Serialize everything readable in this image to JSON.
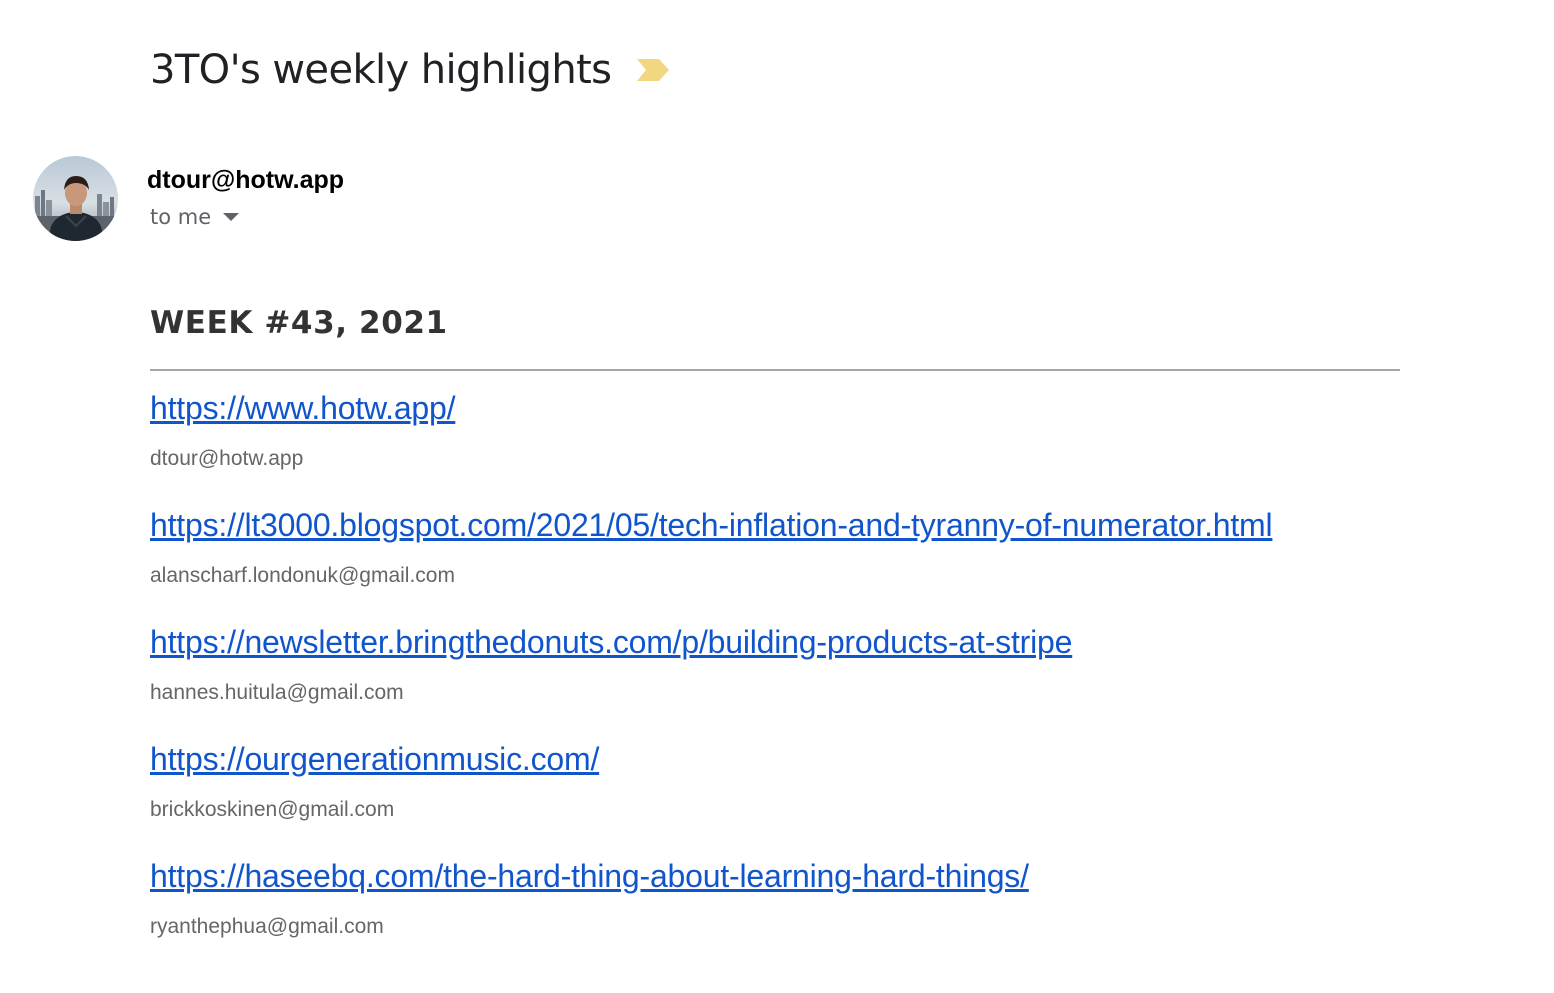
{
  "email": {
    "subject": "3TO's weekly highlights",
    "importance_marker": {
      "icon": "importance-arrow-icon",
      "color": "#f2d680"
    },
    "sender": "dtour@hotw.app",
    "recipient_label": "to me",
    "recipient_dropdown_icon": "caret-down-icon",
    "avatar_icon": "sender-avatar"
  },
  "body": {
    "week_heading": "WEEK #43, 2021",
    "entries": [
      {
        "url": "https://www.hotw.app/",
        "submitter": "dtour@hotw.app"
      },
      {
        "url": "https://lt3000.blogspot.com/2021/05/tech-inflation-and-tyranny-of-numerator.html",
        "submitter": "alanscharf.londonuk@gmail.com"
      },
      {
        "url": "https://newsletter.bringthedonuts.com/p/building-products-at-stripe",
        "submitter": "hannes.huitula@gmail.com"
      },
      {
        "url": "https://ourgenerationmusic.com/",
        "submitter": "brickkoskinen@gmail.com"
      },
      {
        "url": "https://haseebq.com/the-hard-thing-about-learning-hard-things/",
        "submitter": "ryanthephua@gmail.com"
      }
    ]
  },
  "colors": {
    "link": "#1155cc",
    "muted_text": "#666666",
    "divider": "#a6a6a6"
  }
}
